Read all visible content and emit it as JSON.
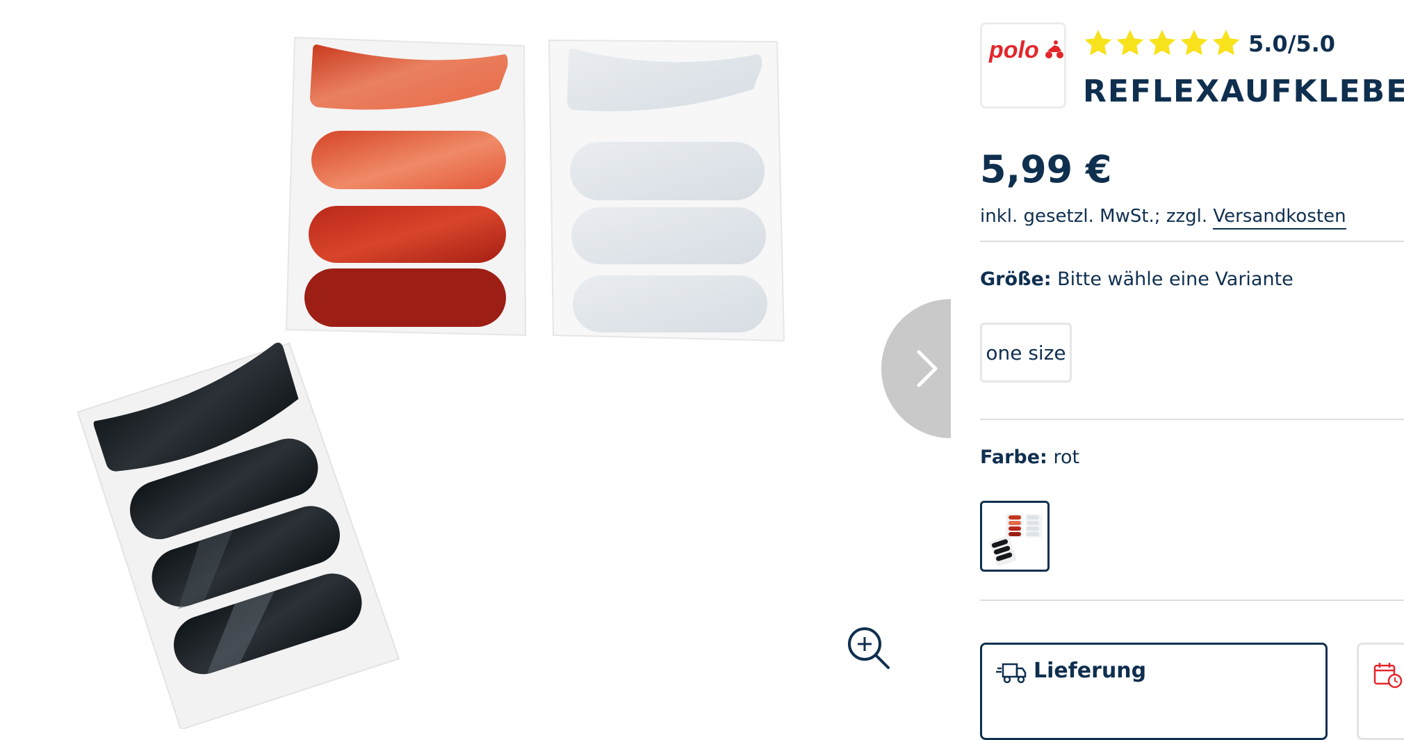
{
  "product": {
    "brand_logo_text": "polo",
    "rating_text": "5.0/5.0",
    "rating_value": 5,
    "rating_max": 5,
    "title": "REFLEXAUFKLEBER",
    "price": "5,99 €",
    "tax_prefix": "inkl. gesetzl. MwSt.; zzgl.",
    "tax_link": "Versandkosten"
  },
  "size": {
    "label": "Größe:",
    "value": "Bitte wähle eine Variante",
    "options": [
      "one size"
    ]
  },
  "color": {
    "label": "Farbe:",
    "value": "rot",
    "selected_swatch_index": 0
  },
  "delivery": {
    "title": "Lieferung",
    "icon": "delivery-truck-icon"
  },
  "pickup": {
    "icon": "calendar-clock-icon"
  },
  "gallery": {
    "icons": [
      "chevron-right-icon",
      "zoom-in-icon"
    ],
    "sticker_colors": {
      "red": "#c7361f",
      "red_light": "#e46a4a",
      "silver": "#dde3e8",
      "black": "#14181c"
    }
  },
  "colors": {
    "text": "#0f2f4f",
    "star": "#f7e21c",
    "brand_red": "#e3262b",
    "divider": "#dddddd"
  }
}
